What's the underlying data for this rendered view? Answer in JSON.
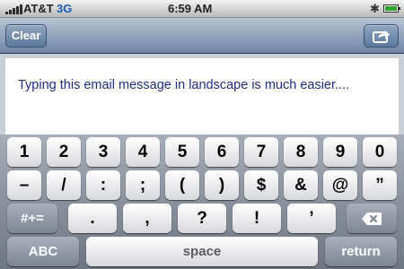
{
  "status_bar": {
    "carrier": "AT&T",
    "network": "3G",
    "time": "6:59 AM",
    "bluetooth_icon": "bluetooth-icon",
    "battery_icon": "battery-icon",
    "signal_bars": 5
  },
  "nav": {
    "clear_label": "Clear",
    "share_icon": "share-icon"
  },
  "message": {
    "text": "Typing this email message in landscape is much easier...."
  },
  "keyboard": {
    "row1": [
      "1",
      "2",
      "3",
      "4",
      "5",
      "6",
      "7",
      "8",
      "9",
      "0"
    ],
    "row2": [
      "–",
      "/",
      ":",
      ";",
      "(",
      ")",
      "$",
      "&",
      "@",
      "”"
    ],
    "row3_mode": "#+=",
    "row3": [
      ".",
      ",",
      "?",
      "!",
      "’"
    ],
    "delete_icon": "backspace-icon",
    "abc_label": "ABC",
    "space_label": "space",
    "return_label": "return"
  },
  "colors": {
    "text_blue": "#1f2d86",
    "nav_blue": "#6e86a4",
    "battery_green": "#2aa82a"
  }
}
